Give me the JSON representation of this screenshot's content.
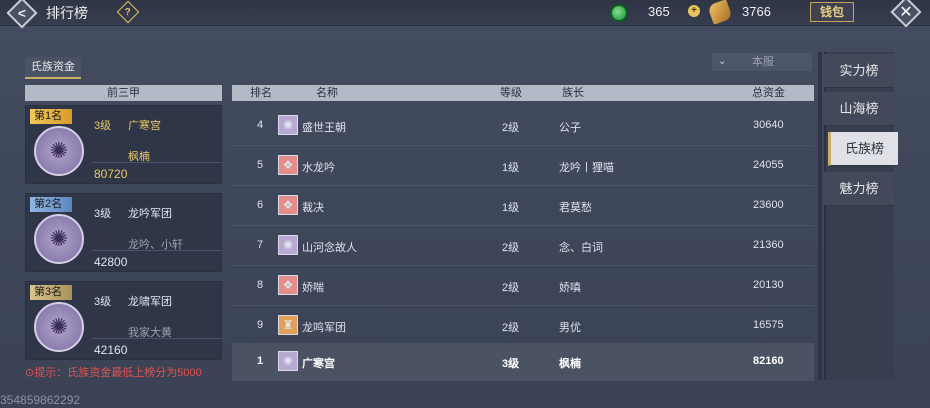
{
  "header": {
    "title": "排行榜",
    "help_icon": "?",
    "currency_jade": "365",
    "currency_gold": "3766",
    "wallet_label": "钱包"
  },
  "tabs": {
    "active": "氏族资金"
  },
  "server_filter": {
    "value": "本服"
  },
  "top3": {
    "header": "前三甲",
    "cards": [
      {
        "rank_label": "第1名",
        "level": "3级",
        "name": "广寒宫",
        "leader": "枫楠",
        "fund": "80720"
      },
      {
        "rank_label": "第2名",
        "level": "3级",
        "name": "龙吟军团",
        "leader": "龙吟、小轩",
        "fund": "42800"
      },
      {
        "rank_label": "第3名",
        "level": "3级",
        "name": "龙啸军团",
        "leader": "我家大黄",
        "fund": "42160"
      }
    ]
  },
  "hint": "提示：氏族资金最低上榜分为5000",
  "watermark": "354859862292",
  "list": {
    "columns": {
      "rank": "排名",
      "name": "名称",
      "level": "等级",
      "leader": "族长",
      "fund": "总资金"
    },
    "rows": [
      {
        "rank": "4",
        "name": "盛世王朝",
        "level": "2级",
        "leader": "公子",
        "fund": "30640"
      },
      {
        "rank": "5",
        "name": "水龙吟",
        "level": "1级",
        "leader": "龙吟丨狸喵",
        "fund": "24055"
      },
      {
        "rank": "6",
        "name": "裁决",
        "level": "1级",
        "leader": "君莫愁",
        "fund": "23600"
      },
      {
        "rank": "7",
        "name": "山河念故人",
        "level": "2级",
        "leader": "念、白词",
        "fund": "21360"
      },
      {
        "rank": "8",
        "name": "娇喘",
        "level": "2级",
        "leader": "娇嗔",
        "fund": "20130"
      },
      {
        "rank": "9",
        "name": "龙鸣军团",
        "level": "2级",
        "leader": "男优",
        "fund": "16575"
      }
    ],
    "mine": {
      "rank": "1",
      "name": "广寒宫",
      "level": "3级",
      "leader": "枫楠",
      "fund": "82160"
    }
  },
  "sidebar": {
    "items": [
      "实力榜",
      "山海榜",
      "氏族榜",
      "魅力榜"
    ],
    "active_index": 2
  },
  "colors": {
    "rank1": "#e2b84b",
    "rank2": "#7fa7d6",
    "rank3": "#c8b37a",
    "hint": "#e0524d",
    "gold_text": "#e8c76a"
  }
}
